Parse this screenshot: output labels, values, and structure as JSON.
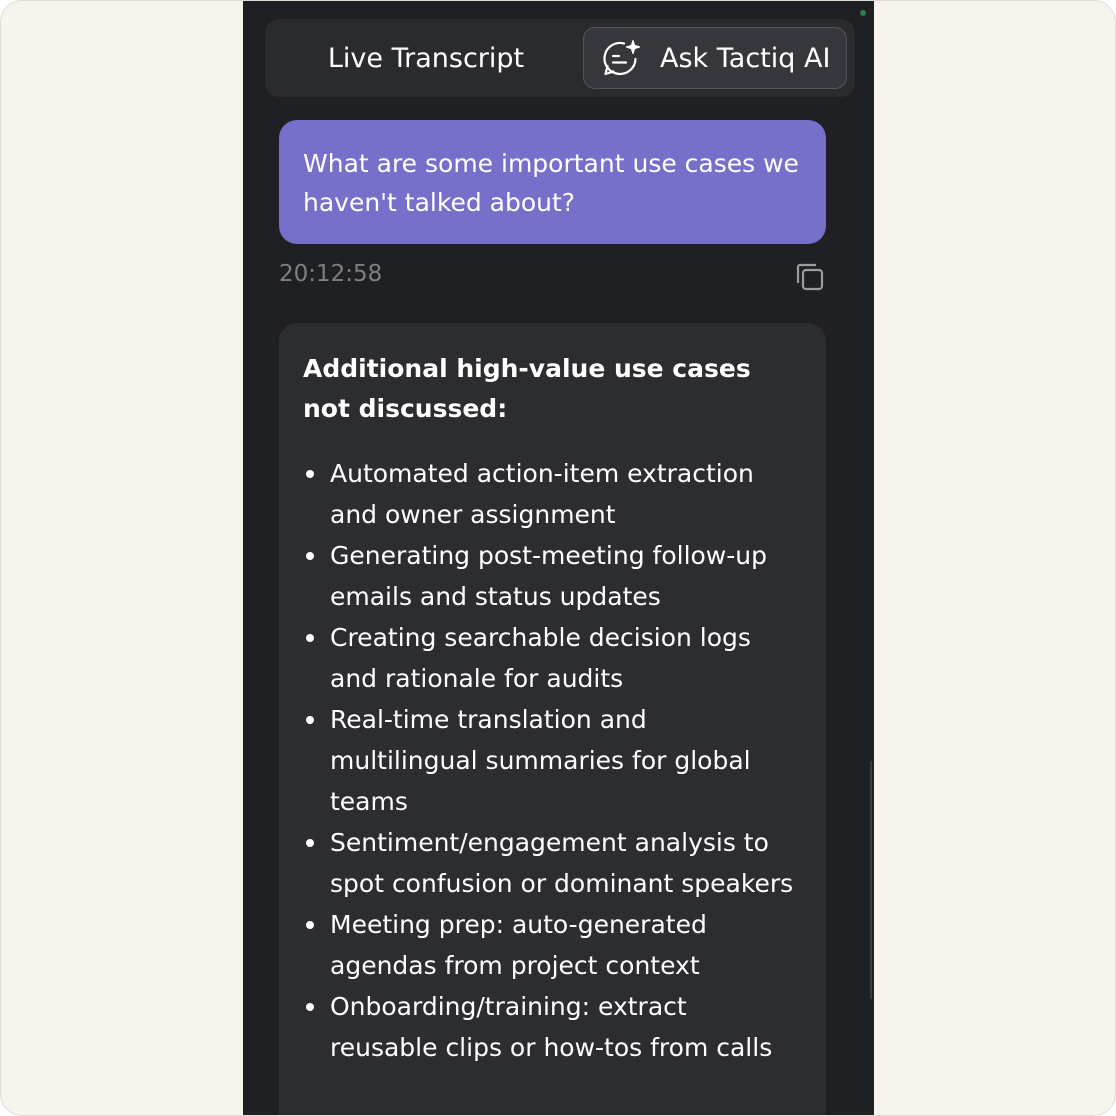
{
  "tabs": {
    "live_transcript": "Live Transcript",
    "ask_ai": "Ask Tactiq AI",
    "ask_ai_icon": "ai-chat-sparkle-icon"
  },
  "conversation": {
    "question": "What are some important use cases we haven't talked about?",
    "timestamp": "20:12:58",
    "copy_icon": "copy-icon",
    "answer": {
      "heading": "Additional high-value use cases not discussed:",
      "items": [
        "Automated action-item extraction and owner assignment",
        "Generating post-meeting follow-up emails and status updates",
        "Creating searchable decision logs and rationale for audits",
        "Real-time translation and multilingual summaries for global teams",
        "Sentiment/engagement analysis to spot confusion or dominant speakers",
        "Meeting prep: auto-generated agendas from project context",
        "Onboarding/training: extract reusable clips or how-tos from calls"
      ]
    }
  },
  "colors": {
    "panel_bg": "#1f2023",
    "user_bubble": "#7670cb",
    "answer_bg": "#2c2d31",
    "page_bg": "#f7f4ee"
  }
}
